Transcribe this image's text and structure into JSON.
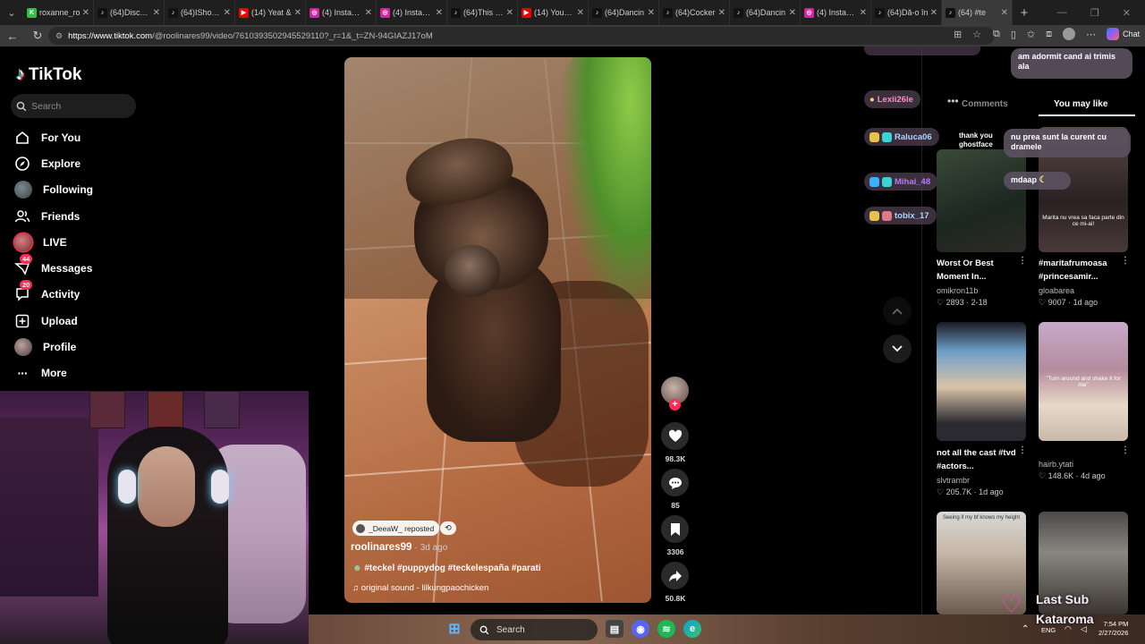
{
  "browser": {
    "tabs": [
      {
        "title": "roxanne_ro",
        "favicon": "K",
        "color": "#2fbf4a"
      },
      {
        "title": "(64)Discove",
        "favicon": "tiktok-icon",
        "color": "#111"
      },
      {
        "title": "(64)IShowS",
        "favicon": "tiktok-icon",
        "color": "#111"
      },
      {
        "title": "(14) Yeat &",
        "favicon": "youtube-icon",
        "color": "#e00"
      },
      {
        "title": "(4) Instagra",
        "favicon": "instagram-icon",
        "color": "#d6249f"
      },
      {
        "title": "(4) Instagra",
        "favicon": "instagram-icon",
        "color": "#d6249f"
      },
      {
        "title": "(64)This CA",
        "favicon": "tiktok-icon",
        "color": "#111"
      },
      {
        "title": "(14) YouTub",
        "favicon": "youtube-icon",
        "color": "#e00"
      },
      {
        "title": "(64)Dancin",
        "favicon": "tiktok-icon",
        "color": "#111"
      },
      {
        "title": "(64)Cocker",
        "favicon": "tiktok-icon",
        "color": "#111"
      },
      {
        "title": "(64)Dancin",
        "favicon": "tiktok-icon",
        "color": "#111"
      },
      {
        "title": "(4) Instagra",
        "favicon": "instagram-icon",
        "color": "#d6249f"
      },
      {
        "title": "(64)Dă-o în",
        "favicon": "tiktok-icon",
        "color": "#111"
      },
      {
        "title": "(64) #te",
        "favicon": "tiktok-icon",
        "color": "#111",
        "active": true
      }
    ],
    "url_host": "https://www.tiktok.com",
    "url_path": "/@roolinares99/video/7610393502945529110?_r=1&_t=ZN-94GIAZJ17oM",
    "chat_label": "Chat"
  },
  "sidebar": {
    "logo_text": "TikTok",
    "search_placeholder": "Search",
    "items": [
      {
        "label": "For You",
        "icon": "home-icon"
      },
      {
        "label": "Explore",
        "icon": "compass-icon"
      },
      {
        "label": "Following",
        "icon": "avatar"
      },
      {
        "label": "Friends",
        "icon": "friends-icon"
      },
      {
        "label": "LIVE",
        "icon": "live-avatar"
      },
      {
        "label": "Messages",
        "icon": "messages-icon",
        "badge": "44"
      },
      {
        "label": "Activity",
        "icon": "activity-icon",
        "badge": "20"
      },
      {
        "label": "Upload",
        "icon": "upload-icon"
      },
      {
        "label": "Profile",
        "icon": "profile-avatar"
      },
      {
        "label": "More",
        "icon": "more-icon"
      }
    ]
  },
  "video": {
    "repost_label": "_DeeaW_ reposted",
    "author": "roolinares99",
    "posted": "· 3d ago",
    "caption": "#teckel #puppydog #teckelespaña #parati",
    "sound": "original sound - lilkungpaochicken"
  },
  "actions": {
    "likes": "98.3K",
    "comments": "85",
    "saves": "3306",
    "shares": "50.8K"
  },
  "chat_overlay": {
    "users": [
      {
        "name": "Lexii26le",
        "color": "#ff7fb0"
      },
      {
        "name": "Raluca06",
        "color": "#9ecbff"
      },
      {
        "name": "Mihai_48",
        "color": "#b06bff"
      },
      {
        "name": "tobix_17",
        "color": "#9ecbff"
      }
    ],
    "messages": [
      "am adormit cand ai trimis ala",
      "thank you ghostface",
      "nu prea sunt la curent cu dramele",
      "mdaap"
    ]
  },
  "right_panel": {
    "tab_comments": "Comments",
    "tab_you_may_like": "You may like",
    "cards": [
      {
        "title": "Worst Or Best Moment In...",
        "author": "omikron11b",
        "likes": "2893",
        "date": "2-18"
      },
      {
        "title": "#maritafrumoasa #princesamir...",
        "author": "gloabarea",
        "likes": "9007",
        "date": "1d ago"
      },
      {
        "title": "not all the cast #tvd #actors...",
        "author": "slvtrambr",
        "likes": "205.7K",
        "date": "1d ago"
      },
      {
        "title": "",
        "author": "hairb.ytati",
        "likes": "148.6K",
        "date": "4d ago"
      },
      {
        "title": "",
        "author": "",
        "likes": "",
        "date": ""
      },
      {
        "title": "",
        "author": "",
        "likes": "",
        "date": ""
      }
    ],
    "thumb_captions": [
      "Marita nu vrea sa faca parte din ce mi-ai!",
      "\"Turn around and shake it for me\"",
      "Seeing if my bf knows my height"
    ]
  },
  "stream_overlay": {
    "last_sub_label": "Last Sub",
    "last_sub_name": "Kataroma"
  },
  "taskbar": {
    "search_placeholder": "Search",
    "lang": "ENG",
    "time": "7:54 PM",
    "date": "2/27/2026"
  }
}
